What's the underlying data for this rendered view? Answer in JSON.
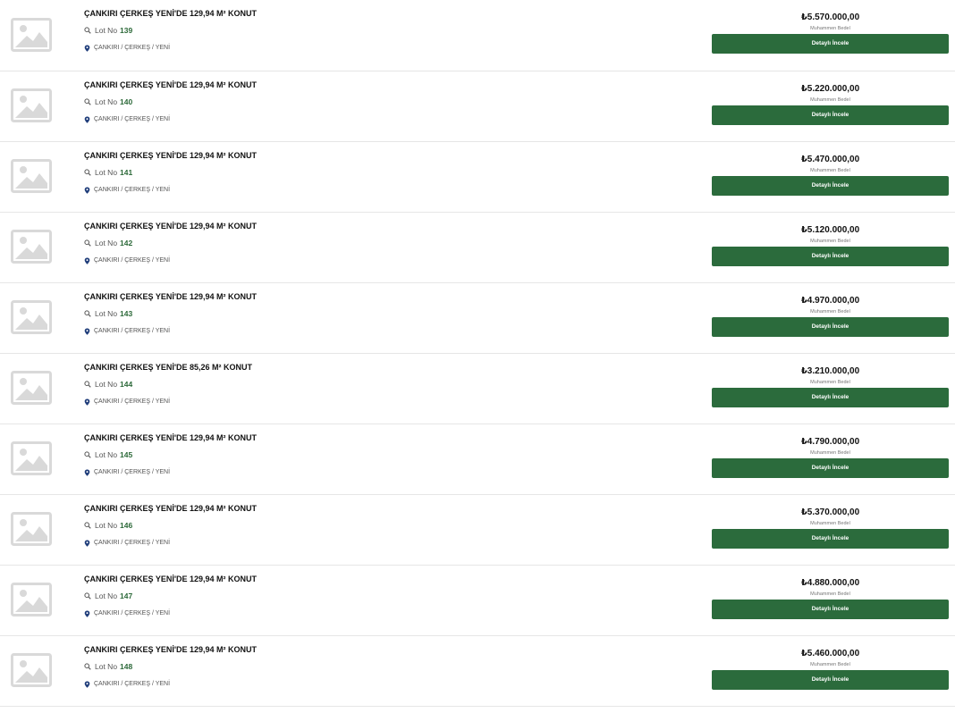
{
  "colors": {
    "accent": "#2b6b3c",
    "lot_number": "#2d6a3a",
    "placeholder": "#d9d9d9"
  },
  "icons": {
    "thumbnail": "image-placeholder-icon",
    "lot": "search-icon",
    "location": "map-pin-icon"
  },
  "listings": [
    {
      "title": "ÇANKIRI ÇERKEŞ YENİ'DE 129,94 M² KONUT",
      "lot_label": "Lot No",
      "lot_number": "139",
      "location": "ÇANKIRI / ÇERKEŞ / YENİ",
      "price": "₺5.570.000,00",
      "price_label": "Muhammen Bedel",
      "button_label": "Detaylı İncele"
    },
    {
      "title": "ÇANKIRI ÇERKEŞ YENİ'DE 129,94 M² KONUT",
      "lot_label": "Lot No",
      "lot_number": "140",
      "location": "ÇANKIRI / ÇERKEŞ / YENİ",
      "price": "₺5.220.000,00",
      "price_label": "Muhammen Bedel",
      "button_label": "Detaylı İncele"
    },
    {
      "title": "ÇANKIRI ÇERKEŞ YENİ'DE 129,94 M² KONUT",
      "lot_label": "Lot No",
      "lot_number": "141",
      "location": "ÇANKIRI / ÇERKEŞ / YENİ",
      "price": "₺5.470.000,00",
      "price_label": "Muhammen Bedel",
      "button_label": "Detaylı İncele"
    },
    {
      "title": "ÇANKIRI ÇERKEŞ YENİ'DE 129,94 M² KONUT",
      "lot_label": "Lot No",
      "lot_number": "142",
      "location": "ÇANKIRI / ÇERKEŞ / YENİ",
      "price": "₺5.120.000,00",
      "price_label": "Muhammen Bedel",
      "button_label": "Detaylı İncele"
    },
    {
      "title": "ÇANKIRI ÇERKEŞ YENİ'DE 129,94 M² KONUT",
      "lot_label": "Lot No",
      "lot_number": "143",
      "location": "ÇANKIRI / ÇERKEŞ / YENİ",
      "price": "₺4.970.000,00",
      "price_label": "Muhammen Bedel",
      "button_label": "Detaylı İncele"
    },
    {
      "title": "ÇANKIRI ÇERKEŞ YENİ'DE 85,26 M² KONUT",
      "lot_label": "Lot No",
      "lot_number": "144",
      "location": "ÇANKIRI / ÇERKEŞ / YENİ",
      "price": "₺3.210.000,00",
      "price_label": "Muhammen Bedel",
      "button_label": "Detaylı İncele"
    },
    {
      "title": "ÇANKIRI ÇERKEŞ YENİ'DE 129,94 M² KONUT",
      "lot_label": "Lot No",
      "lot_number": "145",
      "location": "ÇANKIRI / ÇERKEŞ / YENİ",
      "price": "₺4.790.000,00",
      "price_label": "Muhammen Bedel",
      "button_label": "Detaylı İncele"
    },
    {
      "title": "ÇANKIRI ÇERKEŞ YENİ'DE 129,94 M² KONUT",
      "lot_label": "Lot No",
      "lot_number": "146",
      "location": "ÇANKIRI / ÇERKEŞ / YENİ",
      "price": "₺5.370.000,00",
      "price_label": "Muhammen Bedel",
      "button_label": "Detaylı İncele"
    },
    {
      "title": "ÇANKIRI ÇERKEŞ YENİ'DE 129,94 M² KONUT",
      "lot_label": "Lot No",
      "lot_number": "147",
      "location": "ÇANKIRI / ÇERKEŞ / YENİ",
      "price": "₺4.880.000,00",
      "price_label": "Muhammen Bedel",
      "button_label": "Detaylı İncele"
    },
    {
      "title": "ÇANKIRI ÇERKEŞ YENİ'DE 129,94 M² KONUT",
      "lot_label": "Lot No",
      "lot_number": "148",
      "location": "ÇANKIRI / ÇERKEŞ / YENİ",
      "price": "₺5.460.000,00",
      "price_label": "Muhammen Bedel",
      "button_label": "Detaylı İncele"
    }
  ]
}
